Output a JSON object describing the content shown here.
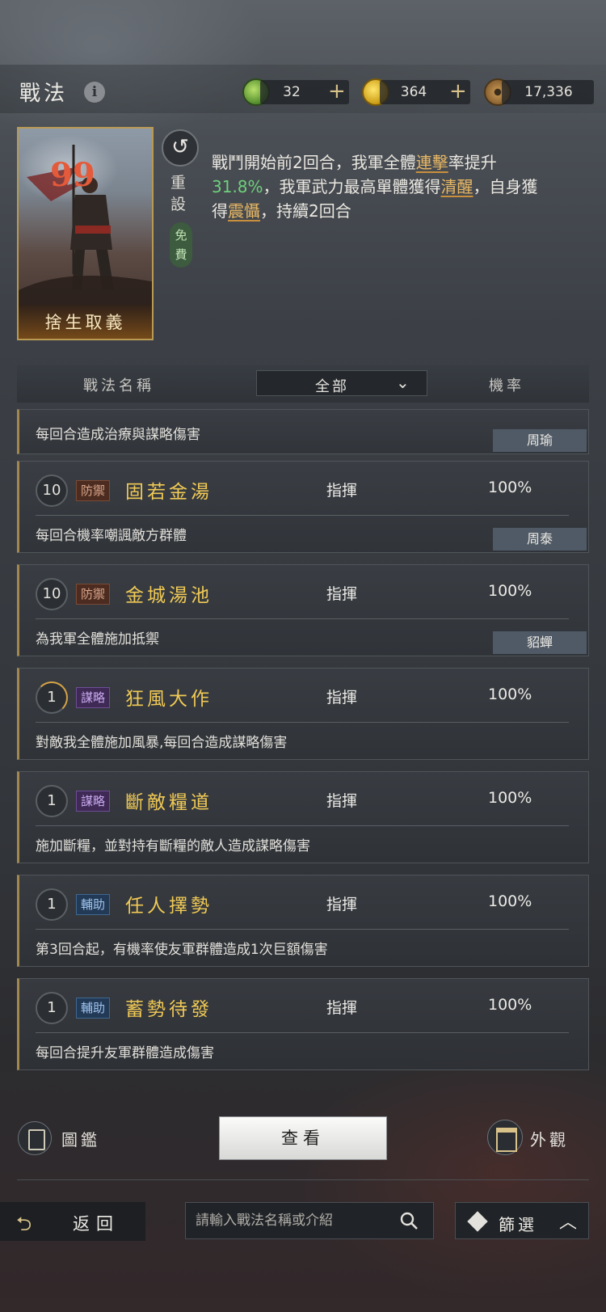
{
  "header": {
    "title": "戰法",
    "info_icon": "i",
    "resources": [
      {
        "icon": "jade-coin-icon",
        "value": "32",
        "plus": "+"
      },
      {
        "icon": "gold-coin-icon",
        "value": "364",
        "plus": "+"
      },
      {
        "icon": "copper-coin-icon",
        "value": "17,336"
      }
    ]
  },
  "detail": {
    "card_name": "捨生取義",
    "card_quote": "99",
    "reset_label": "重設",
    "free_label": "免費",
    "desc": {
      "p1": "戰鬥開始前2回合，我軍全體",
      "k1": "連擊",
      "p2": "率提升",
      "v1": "31.8%",
      "p3": "，我軍武力最高單體獲得",
      "k2": "清醒",
      "p4": "，自身獲得",
      "k3": "震懾",
      "p5": "，持續2回合"
    }
  },
  "list_header": {
    "name_col": "戰法名稱",
    "filter_value": "全部",
    "rate_col": "機率"
  },
  "partial_row": {
    "desc": "每回合造成治療與謀略傷害",
    "hero": "周瑜"
  },
  "rows": [
    {
      "level": "10",
      "tag": "防禦",
      "name": "固若金湯",
      "type": "指揮",
      "rate": "100%",
      "desc": "每回合機率嘲諷敵方群體",
      "hero": "周泰"
    },
    {
      "level": "10",
      "tag": "防禦",
      "name": "金城湯池",
      "type": "指揮",
      "rate": "100%",
      "desc": "為我軍全體施加抵禦",
      "hero": "貂蟬"
    },
    {
      "level": "1",
      "tag": "謀略",
      "name": "狂風大作",
      "type": "指揮",
      "rate": "100%",
      "desc": "對敵我全體施加風暴,每回合造成謀略傷害"
    },
    {
      "level": "1",
      "tag": "謀略",
      "name": "斷敵糧道",
      "type": "指揮",
      "rate": "100%",
      "desc": "施加斷糧，並對持有斷糧的敵人造成謀略傷害"
    },
    {
      "level": "1",
      "tag": "輔助",
      "name": "任人擇勢",
      "type": "指揮",
      "rate": "100%",
      "desc": "第3回合起，有機率使友軍群體造成1次巨額傷害"
    },
    {
      "level": "1",
      "tag": "輔助",
      "name": "蓄勢待發",
      "type": "指揮",
      "rate": "100%",
      "desc": "每回合提升友軍群體造成傷害"
    }
  ],
  "actions": {
    "codex_label": "圖鑑",
    "view_label": "查看",
    "skin_label": "外觀"
  },
  "footer": {
    "back_label": "返回",
    "search_placeholder": "請輸入戰法名稱或介紹",
    "filter_label": "篩選"
  },
  "colors": {
    "gold_name": "#f0c955",
    "highlight": "#e9b864",
    "green_value": "#6fcf7c"
  }
}
